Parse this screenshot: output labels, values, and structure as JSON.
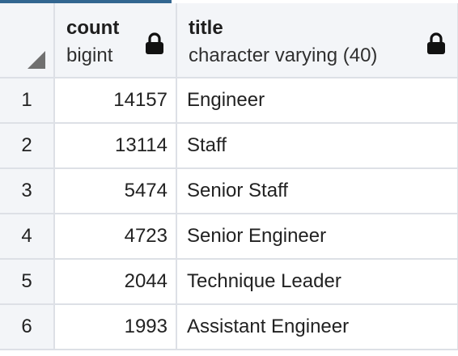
{
  "columns": [
    {
      "name": "count",
      "type": "bigint",
      "icon": "lock-icon"
    },
    {
      "name": "title",
      "type": "character varying (40)",
      "icon": "lock-icon"
    }
  ],
  "rows": [
    {
      "num": "1",
      "count": "14157",
      "title": "Engineer"
    },
    {
      "num": "2",
      "count": "13114",
      "title": "Staff"
    },
    {
      "num": "3",
      "count": "5474",
      "title": "Senior Staff"
    },
    {
      "num": "4",
      "count": "4723",
      "title": "Senior Engineer"
    },
    {
      "num": "5",
      "count": "2044",
      "title": "Technique Leader"
    },
    {
      "num": "6",
      "count": "1993",
      "title": "Assistant Engineer"
    }
  ],
  "colors": {
    "accent": "#326690",
    "header_bg": "#f3f5f8",
    "grid_line": "#dde0e6"
  }
}
